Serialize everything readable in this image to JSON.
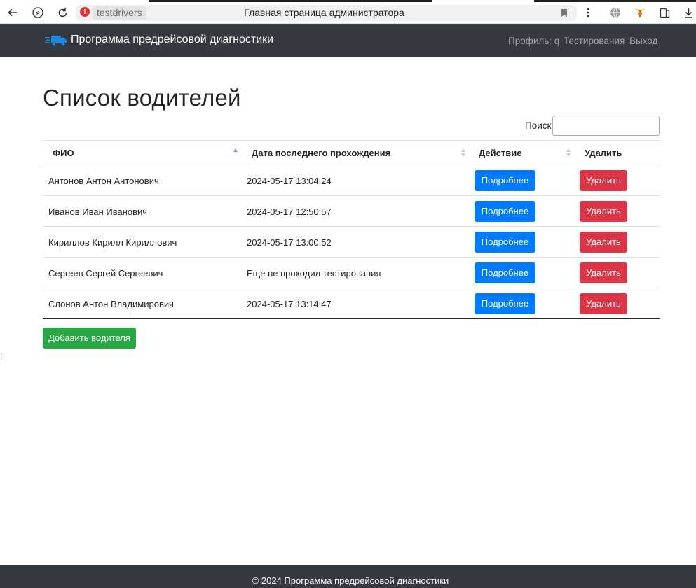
{
  "browser": {
    "url_chip": "testdrivers",
    "tab_title": "Главная страница администратора"
  },
  "navbar": {
    "brand": "Программа предрейсовой диагностики",
    "links": [
      "Профиль: q",
      "Тестирования",
      "Выход"
    ]
  },
  "page": {
    "heading": "Список водителей",
    "search_label": "Поиск",
    "search_value": ""
  },
  "table": {
    "headers": [
      "ФИО",
      "Дата последнего прохождения",
      "Действие",
      "Удалить"
    ],
    "rows": [
      {
        "name": "Антонов Антон Антонович",
        "date": "2024-05-17 13:04:24",
        "details": "Подробнее",
        "delete": "Удалить"
      },
      {
        "name": "Иванов Иван Иванович",
        "date": "2024-05-17 12:50:57",
        "details": "Подробнее",
        "delete": "Удалить"
      },
      {
        "name": "Кириллов Кирилл Кириллович",
        "date": "2024-05-17 13:00:52",
        "details": "Подробнее",
        "delete": "Удалить"
      },
      {
        "name": "Сергеев Сергей Сергеевич",
        "date": "Еще не проходил тестирования",
        "details": "Подробнее",
        "delete": "Удалить"
      },
      {
        "name": "Слонов Антон Владимирович",
        "date": "2024-05-17 13:14:47",
        "details": "Подробнее",
        "delete": "Удалить"
      }
    ]
  },
  "add_button": "Добавить водителя",
  "stray_char": ";",
  "footer": "© 2024 Программа предрейсовой диагностики",
  "colors": {
    "navbar_bg": "#343a40",
    "primary": "#007bff",
    "danger": "#dc3545",
    "success": "#28a745"
  },
  "icons": {
    "back": "back-arrow-icon",
    "yandex": "yandex-logo-icon",
    "reload": "reload-icon",
    "warning": "warning-icon",
    "bookmark": "bookmark-icon",
    "menu": "more-vertical-icon",
    "globe": "globe-icon",
    "fox": "metamask-icon",
    "extensions": "extensions-icon",
    "download": "download-icon",
    "truck": "truck-icon"
  }
}
